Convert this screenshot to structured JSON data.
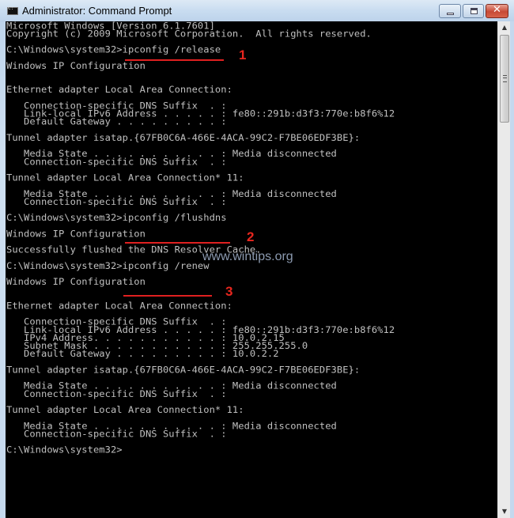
{
  "window": {
    "title": "Administrator: Command Prompt",
    "icon": "cmd-icon",
    "buttons": {
      "minimize": "minimize",
      "maximize": "maximize",
      "close": "✕"
    }
  },
  "console": {
    "lines": [
      "Microsoft Windows [Version 6.1.7601]",
      "Copyright (c) 2009 Microsoft Corporation.  All rights reserved.",
      "",
      "C:\\Windows\\system32>ipconfig /release",
      "",
      "Windows IP Configuration",
      "",
      "",
      "Ethernet adapter Local Area Connection:",
      "",
      "   Connection-specific DNS Suffix  . :",
      "   Link-local IPv6 Address . . . . . : fe80::291b:d3f3:770e:b8f6%12",
      "   Default Gateway . . . . . . . . . :",
      "",
      "Tunnel adapter isatap.{67FB0C6A-466E-4ACA-99C2-F7BE06EDF3BE}:",
      "",
      "   Media State . . . . . . . . . . . : Media disconnected",
      "   Connection-specific DNS Suffix  . :",
      "",
      "Tunnel adapter Local Area Connection* 11:",
      "",
      "   Media State . . . . . . . . . . . : Media disconnected",
      "   Connection-specific DNS Suffix  . :",
      "",
      "C:\\Windows\\system32>ipconfig /flushdns",
      "",
      "Windows IP Configuration",
      "",
      "Successfully flushed the DNS Resolver Cache.",
      "",
      "C:\\Windows\\system32>ipconfig /renew",
      "",
      "Windows IP Configuration",
      "",
      "",
      "Ethernet adapter Local Area Connection:",
      "",
      "   Connection-specific DNS Suffix  . :",
      "   Link-local IPv6 Address . . . . . : fe80::291b:d3f3:770e:b8f6%12",
      "   IPv4 Address. . . . . . . . . . . : 10.0.2.15",
      "   Subnet Mask . . . . . . . . . . . : 255.255.255.0",
      "   Default Gateway . . . . . . . . . : 10.0.2.2",
      "",
      "Tunnel adapter isatap.{67FB0C6A-466E-4ACA-99C2-F7BE06EDF3BE}:",
      "",
      "   Media State . . . . . . . . . . . : Media disconnected",
      "   Connection-specific DNS Suffix  . :",
      "",
      "Tunnel adapter Local Area Connection* 11:",
      "",
      "   Media State . . . . . . . . . . . : Media disconnected",
      "   Connection-specific DNS Suffix  . :",
      "",
      "C:\\Windows\\system32>"
    ]
  },
  "annotations": {
    "steps": [
      {
        "number": "1",
        "command": "ipconfig /release"
      },
      {
        "number": "2",
        "command": "ipconfig /flushdns"
      },
      {
        "number": "3",
        "command": "ipconfig /renew"
      }
    ],
    "watermark": "www.wintips.org",
    "color": "#e02020"
  },
  "scrollbar": {
    "up_arrow": "▲",
    "down_arrow": "▼"
  }
}
